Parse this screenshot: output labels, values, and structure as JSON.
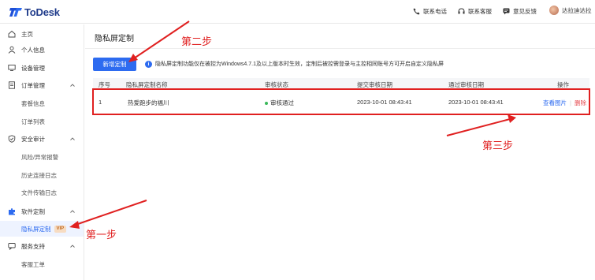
{
  "app": {
    "logo_text": "ToDesk"
  },
  "topbar": {
    "links": [
      {
        "label": "联系电话",
        "icon": "phone-icon"
      },
      {
        "label": "联系客服",
        "icon": "headset-icon"
      },
      {
        "label": "意见反馈",
        "icon": "feedback-icon"
      }
    ],
    "username": "达拉迪达拉"
  },
  "sidebar": {
    "items": [
      {
        "label": "主页",
        "icon": "home-icon"
      },
      {
        "label": "个人信息",
        "icon": "user-icon"
      },
      {
        "label": "设备管理",
        "icon": "device-icon"
      },
      {
        "label": "订单管理",
        "icon": "order-icon"
      },
      {
        "label": "安全审计",
        "icon": "shield-icon"
      },
      {
        "label": "软件定制",
        "icon": "puzzle-icon"
      },
      {
        "label": "服务支持",
        "icon": "support-icon"
      }
    ],
    "sub_order": [
      "套餐信息",
      "订单列表"
    ],
    "sub_security": [
      "风险/异常报警",
      "历史连接日志",
      "文件传输日志"
    ],
    "sub_custom": [
      "隐私屏定制"
    ],
    "vip_badge": "VIP",
    "sub_support": [
      "客服工单"
    ]
  },
  "main": {
    "title": "隐私屏定制",
    "new_button": "新增定制",
    "info_text": "隐私屏定制功能仅在被控为Windows4.7.1及以上版本时生效，定制后被控需登录与主控相同账号方可开启自定义隐私屏",
    "table": {
      "headers": [
        "序号",
        "隐私屏定制名称",
        "审核状态",
        "提交审核日期",
        "通过审核日期",
        "操作"
      ],
      "rows": [
        {
          "index": "1",
          "name": "热爱跑步的福川",
          "status": "审核通过",
          "submitted": "2023-10-01 08:43:41",
          "approved": "2023-10-01 08:43:41",
          "view": "查看图片",
          "delete": "删除"
        }
      ]
    }
  },
  "annotations": {
    "step1": "第一步",
    "step2": "第二步",
    "step3": "第三步"
  },
  "colors": {
    "accent": "#2d6bf0",
    "annotation_red": "#e02020",
    "success": "#3ab85a",
    "vip_bg": "#f7dcc2"
  }
}
